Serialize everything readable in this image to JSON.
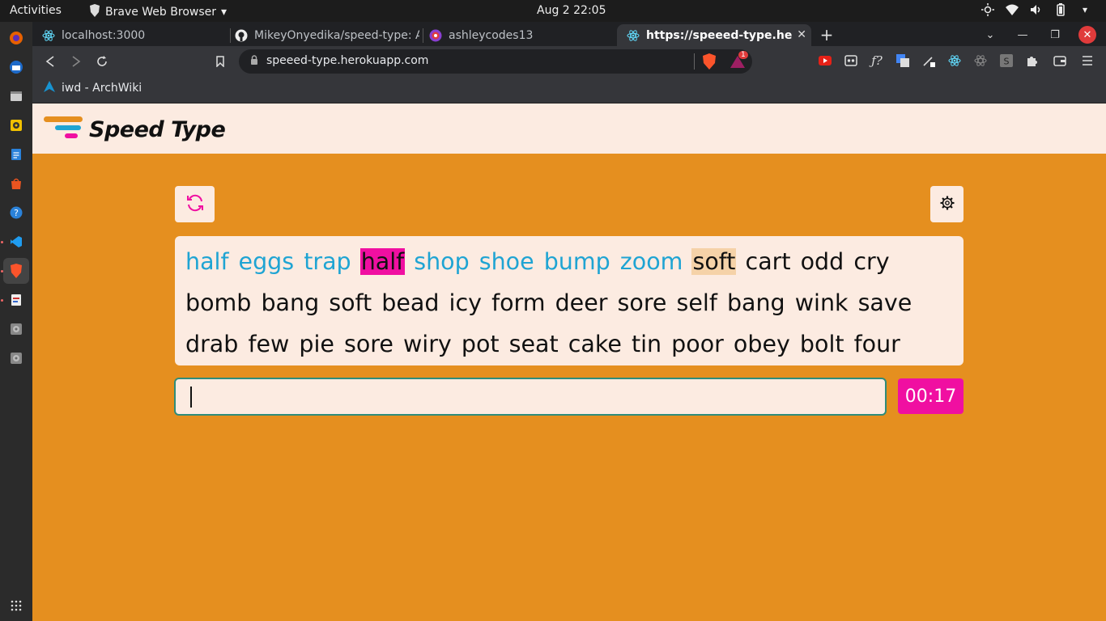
{
  "topbar": {
    "activities": "Activities",
    "app_name": "Brave Web Browser",
    "clock": "Aug 2  22:05"
  },
  "tabs": [
    {
      "label": "localhost:3000"
    },
    {
      "label": "MikeyOnyedika/speed-type: A"
    },
    {
      "label": "ashleycodes13"
    },
    {
      "label": "https://speeed-type.herok"
    }
  ],
  "toolbar": {
    "url": "speeed-type.herokuapp.com",
    "shield_badge": "1"
  },
  "bookmarks": {
    "item1": "iwd - ArchWiki"
  },
  "site": {
    "title": "Speed Type",
    "timer": "00:17",
    "input_value": "",
    "colors": {
      "accent": "#f00fa1",
      "done": "#1fa4d3",
      "bg": "#e58f1f",
      "panel": "#fcebe1",
      "current": "#f5d2a8"
    },
    "words": [
      {
        "t": "half",
        "s": "done"
      },
      {
        "t": "eggs",
        "s": "done"
      },
      {
        "t": "trap",
        "s": "done"
      },
      {
        "t": "half",
        "s": "wrong"
      },
      {
        "t": "shop",
        "s": "done"
      },
      {
        "t": "shoe",
        "s": "done"
      },
      {
        "t": "bump",
        "s": "done"
      },
      {
        "t": "zoom",
        "s": "done"
      },
      {
        "t": "soft",
        "s": "current"
      },
      {
        "t": "cart",
        "s": ""
      },
      {
        "t": "odd",
        "s": ""
      },
      {
        "t": "cry",
        "s": ""
      },
      {
        "t": "bomb",
        "s": ""
      },
      {
        "t": "bang",
        "s": ""
      },
      {
        "t": "soft",
        "s": ""
      },
      {
        "t": "bead",
        "s": ""
      },
      {
        "t": "icy",
        "s": ""
      },
      {
        "t": "form",
        "s": ""
      },
      {
        "t": "deer",
        "s": ""
      },
      {
        "t": "sore",
        "s": ""
      },
      {
        "t": "self",
        "s": ""
      },
      {
        "t": "bang",
        "s": ""
      },
      {
        "t": "wink",
        "s": ""
      },
      {
        "t": "save",
        "s": ""
      },
      {
        "t": "drab",
        "s": ""
      },
      {
        "t": "few",
        "s": ""
      },
      {
        "t": "pie",
        "s": ""
      },
      {
        "t": "sore",
        "s": ""
      },
      {
        "t": "wiry",
        "s": ""
      },
      {
        "t": "pot",
        "s": ""
      },
      {
        "t": "seat",
        "s": ""
      },
      {
        "t": "cake",
        "s": ""
      },
      {
        "t": "tin",
        "s": ""
      },
      {
        "t": "poor",
        "s": ""
      },
      {
        "t": "obey",
        "s": ""
      },
      {
        "t": "bolt",
        "s": ""
      },
      {
        "t": "four",
        "s": ""
      }
    ]
  }
}
